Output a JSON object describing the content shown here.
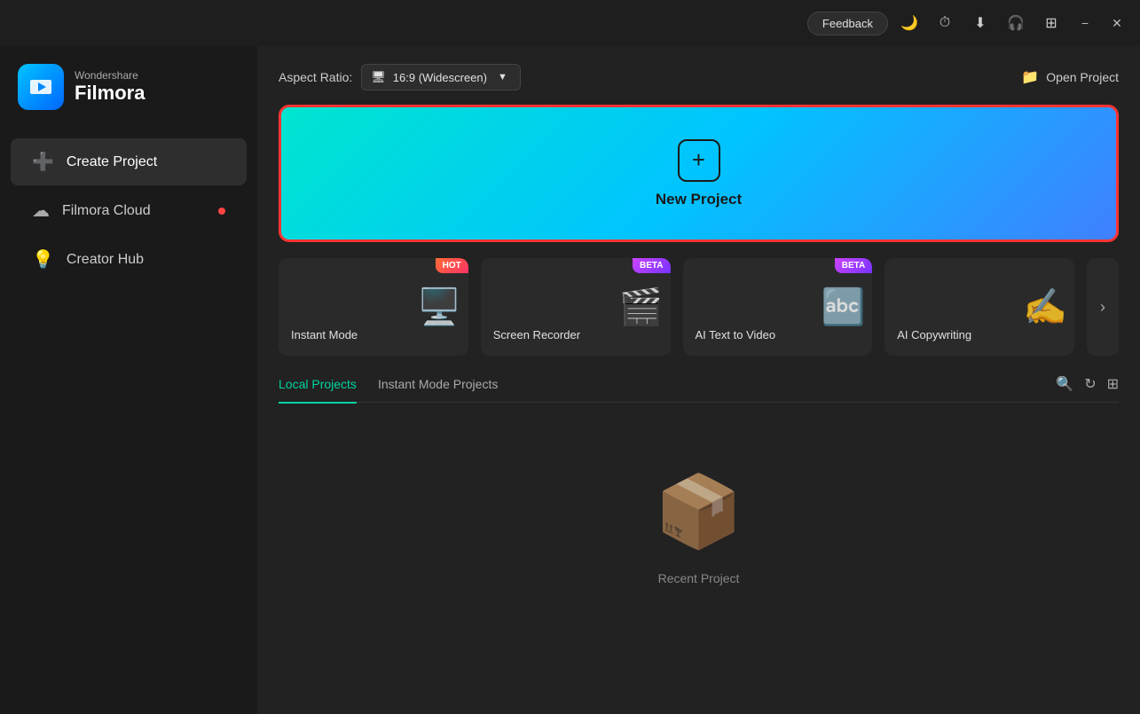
{
  "titleBar": {
    "feedbackLabel": "Feedback",
    "minimizeIcon": "−",
    "gridIcon": "⊞",
    "closeIcon": "✕"
  },
  "logo": {
    "wonder": "Wondershare",
    "filmora": "Filmora"
  },
  "sidebar": {
    "items": [
      {
        "id": "create-project",
        "label": "Create Project",
        "icon": "➕",
        "active": true,
        "dot": false
      },
      {
        "id": "filmora-cloud",
        "label": "Filmora Cloud",
        "icon": "☁",
        "active": false,
        "dot": true
      },
      {
        "id": "creator-hub",
        "label": "Creator Hub",
        "icon": "💡",
        "active": false,
        "dot": false
      }
    ]
  },
  "topBar": {
    "aspectRatioLabel": "Aspect Ratio:",
    "aspectRatioValue": "16:9 (Widescreen)",
    "openProjectLabel": "Open Project"
  },
  "newProject": {
    "label": "New Project"
  },
  "quickCards": [
    {
      "id": "instant-mode",
      "label": "Instant Mode",
      "badge": "HOT",
      "badgeType": "hot",
      "icon": "🖥️"
    },
    {
      "id": "screen-recorder",
      "label": "Screen Recorder",
      "badge": "BETA",
      "badgeType": "beta",
      "icon": "🎬"
    },
    {
      "id": "ai-text-to-video",
      "label": "AI Text to Video",
      "badge": "BETA",
      "badgeType": "beta",
      "icon": "🔤"
    },
    {
      "id": "ai-copywriting",
      "label": "AI Copywriting",
      "badge": "",
      "badgeType": "",
      "icon": "✍️"
    }
  ],
  "projectsTabs": [
    {
      "id": "local-projects",
      "label": "Local Projects",
      "active": true
    },
    {
      "id": "instant-mode-projects",
      "label": "Instant Mode Projects",
      "active": false
    }
  ],
  "emptyState": {
    "icon": "📦",
    "label": "Recent Project"
  }
}
